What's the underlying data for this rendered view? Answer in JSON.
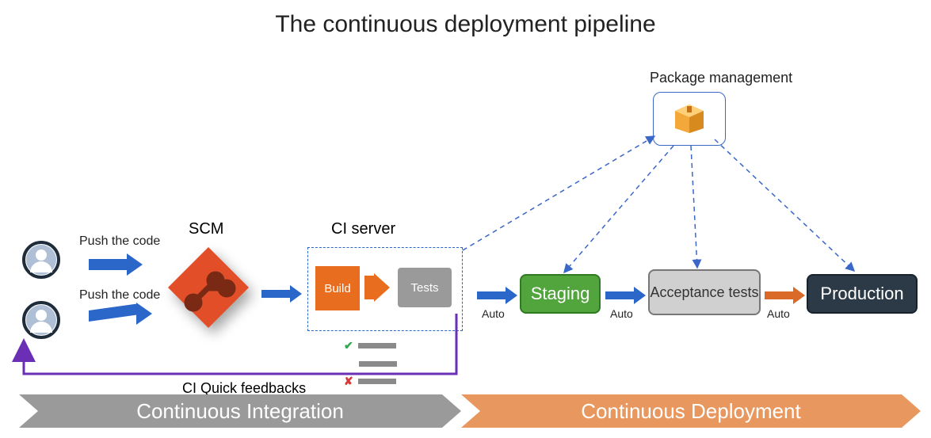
{
  "title": "The continuous deployment pipeline",
  "package_management": {
    "label": "Package management"
  },
  "scm": {
    "label": "SCM"
  },
  "ci_server": {
    "label": "CI server",
    "build": "Build",
    "tests": "Tests"
  },
  "push": {
    "label1": "Push the code",
    "label2": "Push the code"
  },
  "auto": {
    "label1": "Auto",
    "label2": "Auto",
    "label3": "Auto"
  },
  "nodes": {
    "staging": "Staging",
    "acceptance": "Acceptance tests",
    "production": "Production"
  },
  "feedback": {
    "label": "CI Quick feedbacks"
  },
  "banners": {
    "ci": "Continuous Integration",
    "cd": "Continuous Deployment"
  }
}
